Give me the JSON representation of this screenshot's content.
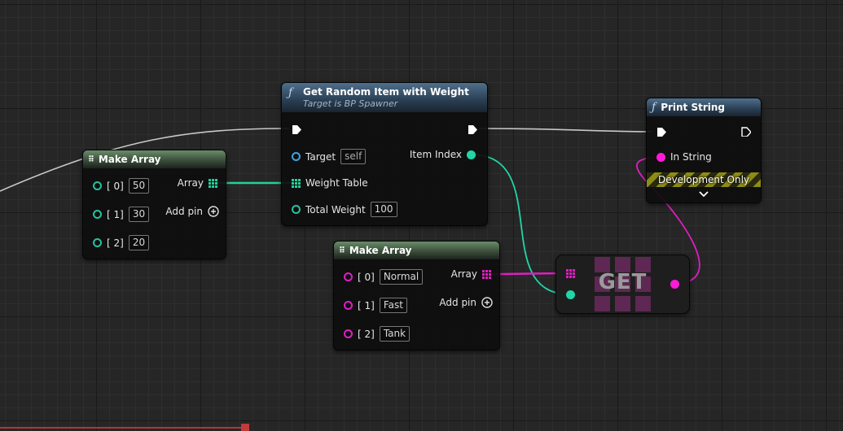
{
  "colors": {
    "integer": "#20d6a6",
    "string": "#e01ec2",
    "object": "#3ea2e0",
    "exec": "#ffffff",
    "header_pure": "#4a6a4a",
    "header_function": "#3b5873"
  },
  "make_array_1": {
    "title": "Make Array",
    "icon": "array-grid-icon",
    "inputs": [
      {
        "label": "[ 0]",
        "value": "50"
      },
      {
        "label": "[ 1]",
        "value": "30"
      },
      {
        "label": "[ 2]",
        "value": "20"
      }
    ],
    "output_label": "Array",
    "add_pin_label": "Add pin"
  },
  "get_random": {
    "title": "Get Random Item with Weight",
    "subtitle": "Target is BP Spawner",
    "icon": "function-icon",
    "target_label": "Target",
    "target_value": "self",
    "weight_table_label": "Weight Table",
    "total_weight_label": "Total Weight",
    "total_weight_value": "100",
    "item_index_label": "Item Index"
  },
  "print_string": {
    "title": "Print String",
    "icon": "function-icon",
    "in_string_label": "In String",
    "dev_only_label": "Development Only"
  },
  "make_array_2": {
    "title": "Make Array",
    "icon": "array-grid-icon",
    "inputs": [
      {
        "label": "[ 0]",
        "value": "Normal"
      },
      {
        "label": "[ 1]",
        "value": "Fast"
      },
      {
        "label": "[ 2]",
        "value": "Tank"
      }
    ],
    "output_label": "Array",
    "add_pin_label": "Add pin"
  },
  "get_node": {
    "label": "GET"
  }
}
